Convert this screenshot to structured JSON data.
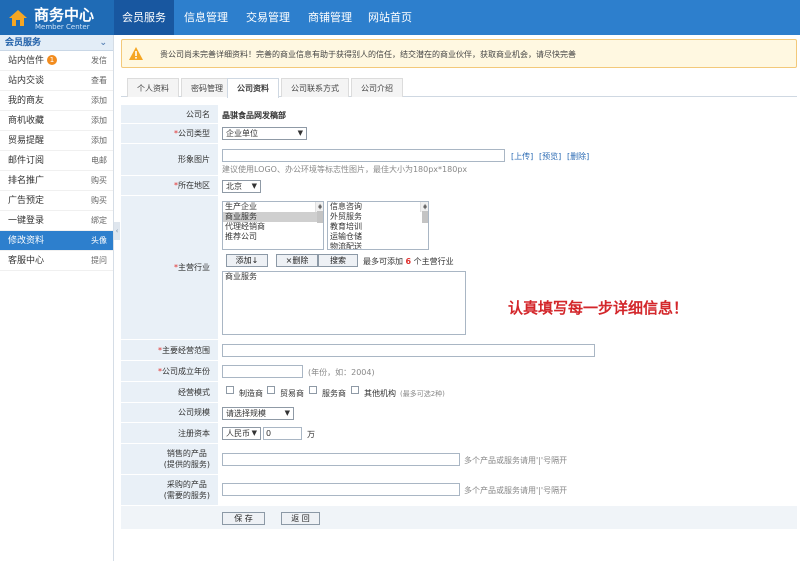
{
  "header": {
    "logo_title": "商务中心",
    "logo_subtitle": "Member Center",
    "nav": [
      "会员服务",
      "信息管理",
      "交易管理",
      "商铺管理",
      "网站首页"
    ]
  },
  "sidebar": {
    "heading": "会员服务",
    "items": [
      {
        "label": "站内信件",
        "action": "发信",
        "badge": "1"
      },
      {
        "label": "站内交谈",
        "action": "查看"
      },
      {
        "label": "我的商友",
        "action": "添加"
      },
      {
        "label": "商机收藏",
        "action": "添加"
      },
      {
        "label": "贸易提醒",
        "action": "添加"
      },
      {
        "label": "邮件订阅",
        "action": "电邮"
      },
      {
        "label": "排名推广",
        "action": "购买"
      },
      {
        "label": "广告预定",
        "action": "购买"
      },
      {
        "label": "一键登录",
        "action": "绑定"
      },
      {
        "label": "修改资料",
        "action": "头像",
        "active": true
      },
      {
        "label": "客服中心",
        "action": "提问"
      }
    ]
  },
  "notice": "贵公司尚未完善详细资料！完善的商业信息有助于获得别人的信任，结交潜在的商业伙伴，获取商业机会，请尽快完善",
  "tabs": [
    "个人资料",
    "密码管理",
    "公司资料",
    "公司联系方式",
    "公司介绍"
  ],
  "form": {
    "company_name": {
      "label": "公司名",
      "value": "晶骐食品网发稿部"
    },
    "company_type": {
      "label": "公司类型",
      "value": "企业单位"
    },
    "image": {
      "label": "形象图片",
      "upload": "[上传]",
      "preview": "[预览]",
      "delete": "[删除]",
      "hint": "建议使用LOGO、办公环境等标志性图片，最佳大小为180px*180px"
    },
    "region": {
      "label": "所在地区",
      "value": "北京"
    },
    "industry": {
      "label": "主营行业",
      "left_options": [
        "生产企业",
        "商业服务",
        "代理经销商",
        "推荐公司"
      ],
      "right_options": [
        "信息咨询",
        "外贸服务",
        "教育培训",
        "运输仓储",
        "物流配送"
      ],
      "add_button": "添加↓",
      "remove_button": "×删除",
      "search_button": "搜索",
      "limit_text_prefix": "最多可添加",
      "limit_number": "6",
      "limit_text_suffix": "个主营行业",
      "selected": "商业服务"
    },
    "scope": {
      "label": "主要经营范围"
    },
    "founded": {
      "label": "公司成立年份",
      "hint": "(年份，如：2004)"
    },
    "mode": {
      "label": "经营模式",
      "options": [
        "制造商",
        "贸易商",
        "服务商",
        "其他机构"
      ],
      "hint": "(最多可选2种)"
    },
    "size": {
      "label": "公司规模",
      "value": "请选择规模"
    },
    "capital": {
      "label": "注册资本",
      "currency": "人民币",
      "amount": "0",
      "unit": "万"
    },
    "sell": {
      "label_line1": "销售的产品",
      "label_line2": "(提供的服务)",
      "hint": "多个产品或服务请用'|'号隔开"
    },
    "buy": {
      "label_line1": "采购的产品",
      "label_line2": "(需要的服务)",
      "hint": "多个产品或服务请用'|'号隔开"
    },
    "save_button": "保 存",
    "back_button": "返 回"
  },
  "slogan": "认真填写每一步详细信息！"
}
